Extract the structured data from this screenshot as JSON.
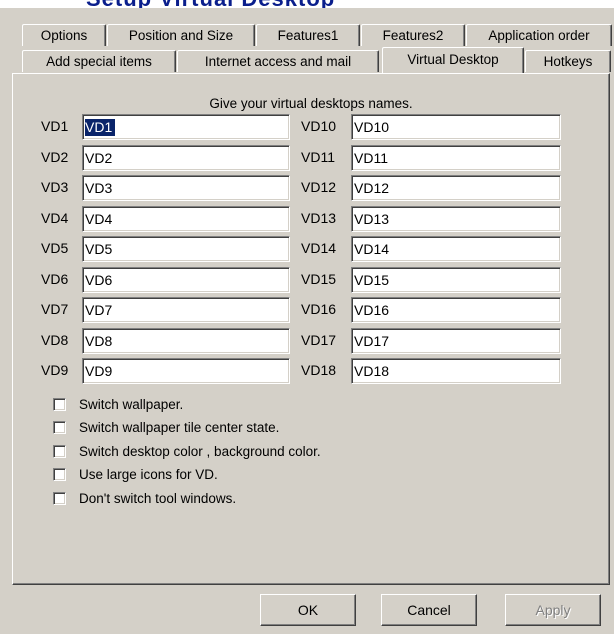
{
  "window": {
    "title": "Setup Virtual Desktop"
  },
  "tabs": {
    "row1": [
      "Options",
      "Position and Size",
      "Features1",
      "Features2",
      "Application order"
    ],
    "row2": [
      "Add special items",
      "Internet access and mail",
      "Virtual Desktop",
      "Hotkeys"
    ],
    "active": "Virtual Desktop"
  },
  "panel": {
    "hint": "Give your virtual desktops names.",
    "desktops_left": [
      {
        "label": "VD1",
        "value": "VD1"
      },
      {
        "label": "VD2",
        "value": "VD2"
      },
      {
        "label": "VD3",
        "value": "VD3"
      },
      {
        "label": "VD4",
        "value": "VD4"
      },
      {
        "label": "VD5",
        "value": "VD5"
      },
      {
        "label": "VD6",
        "value": "VD6"
      },
      {
        "label": "VD7",
        "value": "VD7"
      },
      {
        "label": "VD8",
        "value": "VD8"
      },
      {
        "label": "VD9",
        "value": "VD9"
      }
    ],
    "desktops_right": [
      {
        "label": "VD10",
        "value": "VD10"
      },
      {
        "label": "VD11",
        "value": "VD11"
      },
      {
        "label": "VD12",
        "value": "VD12"
      },
      {
        "label": "VD13",
        "value": "VD13"
      },
      {
        "label": "VD14",
        "value": "VD14"
      },
      {
        "label": "VD15",
        "value": "VD15"
      },
      {
        "label": "VD16",
        "value": "VD16"
      },
      {
        "label": "VD17",
        "value": "VD17"
      },
      {
        "label": "VD18",
        "value": "VD18"
      }
    ],
    "options": [
      {
        "label": "Switch wallpaper.",
        "checked": false
      },
      {
        "label": "Switch wallpaper tile center state.",
        "checked": false
      },
      {
        "label": "Switch desktop color , background color.",
        "checked": false
      },
      {
        "label": "Use large icons for VD.",
        "checked": false
      },
      {
        "label": "Don't switch tool windows.",
        "checked": false
      }
    ]
  },
  "buttons": {
    "ok": "OK",
    "cancel": "Cancel",
    "apply": "Apply"
  }
}
